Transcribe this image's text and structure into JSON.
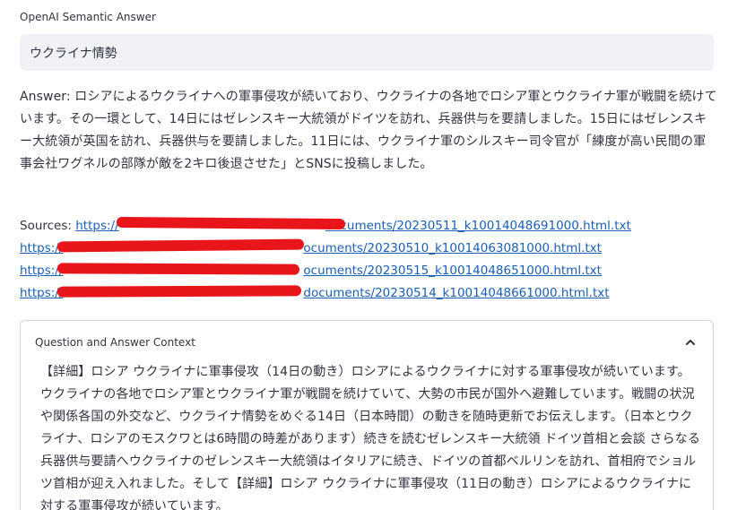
{
  "app": {
    "title": "OpenAI Semantic Answer"
  },
  "query": {
    "value": "ウクライナ情勢"
  },
  "answer": {
    "text": "Answer: ロシアによるウクライナへの軍事侵攻が続いており、ウクライナの各地でロシア軍とウクライナ軍が戦闘を続けています。その一環として、14日にはゼレンスキー大統領がドイツを訪れ、兵器供与を要請しました。15日にはゼレンスキー大統領が英国を訪れ、兵器供与を要請しました。11日には、ウクライナ軍のシルスキー司令官が「練度が高い民間の軍事会社ワグネルの部隊が敵を2キロ後退させた」とSNSに投稿しました。"
  },
  "sources": {
    "label": "Sources:",
    "links": [
      {
        "prefix": "https://",
        "suffix": "documents/20230511_k10014048691000.html.txt"
      },
      {
        "prefix": "https://",
        "suffix": "ocuments/20230510_k10014063081000.html.txt"
      },
      {
        "prefix": "https://",
        "suffix": "ocuments/20230515_k10014048651000.html.txt"
      },
      {
        "prefix": "https://",
        "suffix": "documents/20230514_k10014048661000.html.txt"
      }
    ],
    "redaction_color": "#e8151a"
  },
  "context": {
    "title": "Question and Answer Context",
    "expanded": true,
    "text": "【詳細】ロシア ウクライナに軍事侵攻（14日の動き）ロシアによるウクライナに対する軍事侵攻が続いています。ウクライナの各地でロシア軍とウクライナ軍が戦闘を続けていて、大勢の市民が国外へ避難しています。戦闘の状況や関係各国の外交など、ウクライナ情勢をめぐる14日（日本時間）の動きを随時更新でお伝えします。（日本とウクライナ、ロシアのモスクワとは6時間の時差があります）続きを読むゼレンスキー大統領 ドイツ首相と会談 さらなる兵器供与要請へウクライナのゼレンスキー大統領はイタリアに続き、ドイツの首都ベルリンを訪れ、首相府でショルツ首相が迎え入れました。そして【詳細】ロシア ウクライナに軍事侵攻（11日の動き）ロシアによるウクライナに対する軍事侵攻が続いています。"
  },
  "icons": {
    "chevron": "chevron-up-icon"
  }
}
